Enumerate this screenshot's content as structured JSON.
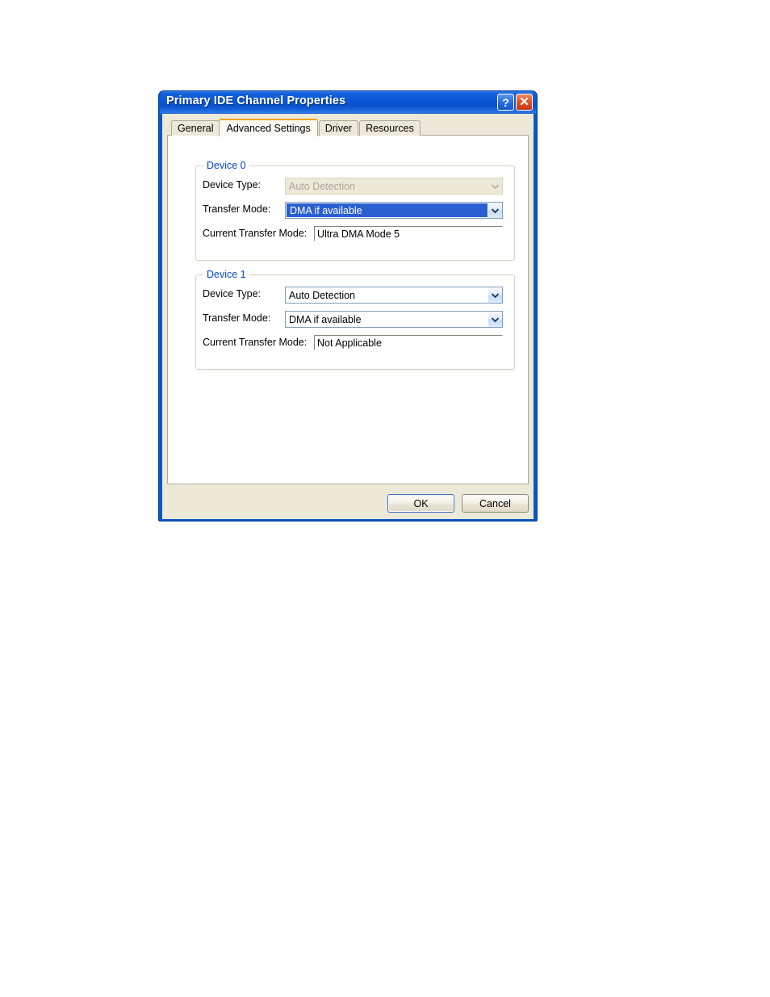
{
  "window": {
    "title": "Primary IDE Channel Properties",
    "titlebar_buttons": [
      {
        "name": "help-button",
        "glyph": "?"
      },
      {
        "name": "close-button",
        "glyph": "✕"
      }
    ],
    "accent_title_color": "#0a57d6",
    "client_bg_color": "#ece9d8"
  },
  "tabs": {
    "active_index": 1,
    "active_tab_accent_color": "#f2a30a",
    "items": [
      {
        "label": "General"
      },
      {
        "label": "Advanced Settings"
      },
      {
        "label": "Driver"
      },
      {
        "label": "Resources"
      }
    ]
  },
  "groups": [
    {
      "legend": "Device 0",
      "legend_color": "#0046d5",
      "rows": {
        "device_type": {
          "label": "Device Type:",
          "value": "Auto Detection",
          "state": "disabled",
          "control": "combobox"
        },
        "transfer_mode": {
          "label": "Transfer Mode:",
          "value": "DMA if available",
          "state": "focused",
          "control": "combobox",
          "selection_color": "#2a5fd0"
        },
        "current_transfer_mode": {
          "label": "Current Transfer Mode:",
          "value": "Ultra DMA Mode 5",
          "state": "readonly",
          "control": "textfield"
        }
      }
    },
    {
      "legend": "Device 1",
      "legend_color": "#0046d5",
      "rows": {
        "device_type": {
          "label": "Device Type:",
          "value": "Auto Detection",
          "state": "enabled",
          "control": "combobox"
        },
        "transfer_mode": {
          "label": "Transfer Mode:",
          "value": "DMA if available",
          "state": "enabled",
          "control": "combobox"
        },
        "current_transfer_mode": {
          "label": "Current Transfer Mode:",
          "value": "Not Applicable",
          "state": "readonly",
          "control": "textfield"
        }
      }
    }
  ],
  "footer": {
    "ok_label": "OK",
    "cancel_label": "Cancel",
    "default_button": "OK"
  }
}
